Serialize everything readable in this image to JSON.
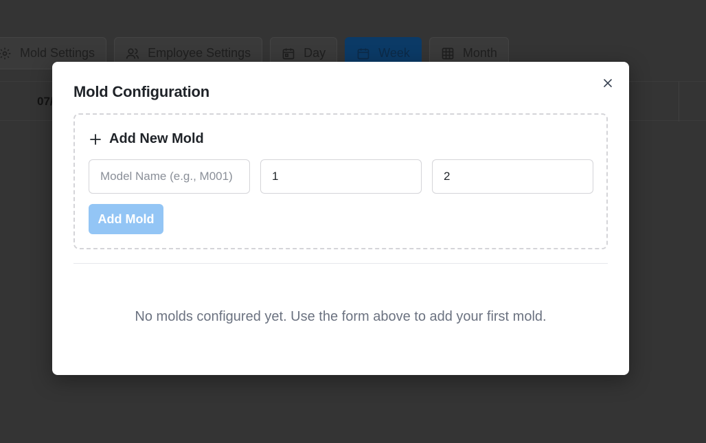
{
  "toolbar": {
    "items": [
      {
        "label": "Mold Settings",
        "icon": "gear-icon"
      },
      {
        "label": "Employee Settings",
        "icon": "users-icon"
      },
      {
        "label": "Day",
        "icon": "calendar-icon"
      },
      {
        "label": "Week",
        "icon": "calendar-icon",
        "active": true
      },
      {
        "label": "Month",
        "icon": "grid-icon"
      }
    ]
  },
  "calendar": {
    "first_date": "07/"
  },
  "modal": {
    "title": "Mold Configuration",
    "add_section": {
      "heading": "Add New Mold",
      "model_name": {
        "value": "",
        "placeholder": "Model Name (e.g., M001)"
      },
      "field_2": {
        "value": "1"
      },
      "field_3": {
        "value": "2"
      },
      "add_button": "Add Mold"
    },
    "empty_message": "No molds configured yet. Use the form above to add your first mold."
  },
  "colors": {
    "accent_disabled": "#93c5f5",
    "active_tab": "#0b3a66"
  }
}
